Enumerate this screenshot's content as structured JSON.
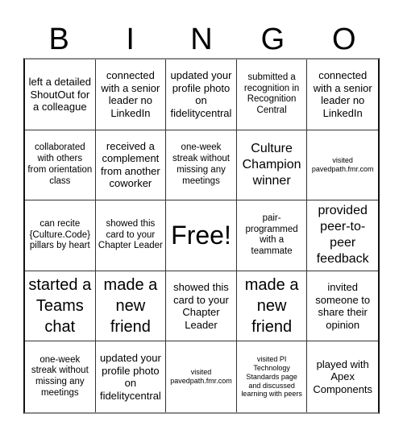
{
  "header": {
    "letters": [
      "B",
      "I",
      "N",
      "G",
      "O"
    ]
  },
  "board": {
    "cells": [
      {
        "text": "left a detailed ShoutOut for a colleague",
        "size": "md"
      },
      {
        "text": "connected with a senior leader no LinkedIn",
        "size": "md"
      },
      {
        "text": "updated your profile photo on fidelitycentral",
        "size": "md"
      },
      {
        "text": "submitted a recognition in Recognition Central",
        "size": "sm"
      },
      {
        "text": "connected with a senior leader no LinkedIn",
        "size": "md"
      },
      {
        "text": "collaborated with others from orientation class",
        "size": "sm"
      },
      {
        "text": "received a complement from another coworker",
        "size": "md"
      },
      {
        "text": "one-week streak without missing any meetings",
        "size": "sm"
      },
      {
        "text": "Culture Champion winner",
        "size": "lg"
      },
      {
        "text": "visited pavedpath.fmr.com",
        "size": "xs"
      },
      {
        "text": "can recite {Culture.Code} pillars by heart",
        "size": "sm"
      },
      {
        "text": "showed this card to your Chapter Leader",
        "size": "sm"
      },
      {
        "text": "Free!",
        "size": "free"
      },
      {
        "text": "pair-programmed with a teammate",
        "size": "sm"
      },
      {
        "text": "provided peer-to-peer feedback",
        "size": "lg"
      },
      {
        "text": "started a Teams chat",
        "size": "xl"
      },
      {
        "text": "made a new friend",
        "size": "xl"
      },
      {
        "text": "showed this card to your Chapter Leader",
        "size": "md"
      },
      {
        "text": "made a new friend",
        "size": "xl"
      },
      {
        "text": "invited someone to share their opinion",
        "size": "md"
      },
      {
        "text": "one-week streak without missing any meetings",
        "size": "sm"
      },
      {
        "text": "updated your profile photo on fidelitycentral",
        "size": "md"
      },
      {
        "text": "visited pavedpath.fmr.com",
        "size": "xs"
      },
      {
        "text": "visited PI Technology Standards page and discussed learning with peers",
        "size": "xs"
      },
      {
        "text": "played with Apex Components",
        "size": "md"
      }
    ]
  }
}
